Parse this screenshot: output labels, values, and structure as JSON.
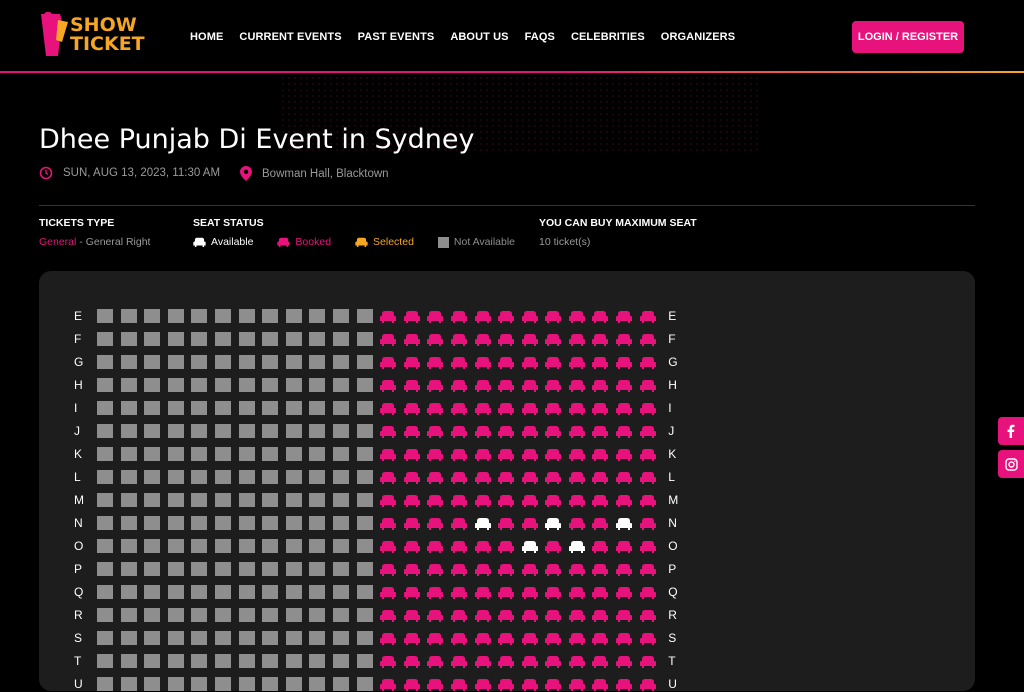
{
  "brand": {
    "logo_line1": "SHOW",
    "logo_line2": "TICKET",
    "colors": {
      "pink": "#e8127c",
      "orange": "#f5a623"
    }
  },
  "nav": {
    "items": [
      "HOME",
      "CURRENT EVENTS",
      "PAST EVENTS",
      "ABOUT US",
      "FAQS",
      "CELEBRITIES",
      "ORGANIZERS"
    ],
    "login_label": "LOGIN / REGISTER"
  },
  "event": {
    "title": "Dhee Punjab Di Event in Sydney",
    "datetime": "SUN, AUG 13, 2023, 11:30 AM",
    "venue": "Bowman Hall, Blacktown"
  },
  "tickets": {
    "type_heading": "TICKETS TYPE",
    "type_name": "General",
    "type_detail": " - General Right",
    "status_heading": "SEAT STATUS",
    "status_available": "Available",
    "status_booked": "Booked",
    "status_selected": "Selected",
    "status_not_available": "Not Available",
    "max_heading": "YOU CAN BUY MAXIMUM SEAT",
    "max_value": "10 ticket(s)"
  },
  "seat_map": {
    "rows": [
      "E",
      "F",
      "G",
      "H",
      "I",
      "J",
      "K",
      "L",
      "M",
      "N",
      "O",
      "P",
      "Q",
      "R",
      "S",
      "T",
      "U"
    ],
    "not_available_count": 12,
    "seat_count": 12,
    "available_seats": {
      "N": [
        4,
        7,
        10
      ],
      "O": [
        6,
        8
      ]
    }
  },
  "social": {
    "icons": [
      "facebook-icon",
      "instagram-icon"
    ]
  }
}
